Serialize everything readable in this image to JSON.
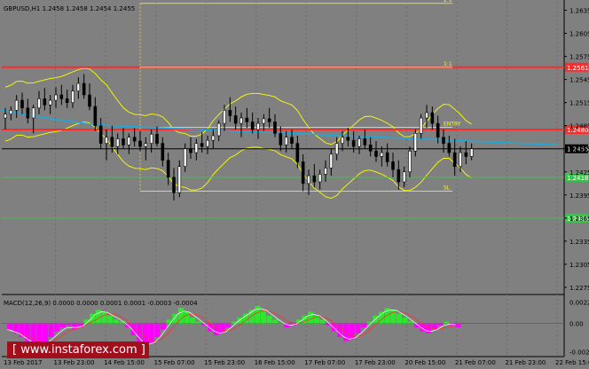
{
  "chart_data": [
    {
      "type": "candlestick",
      "title": "GBPUSD,H1  1.2458 1.2458 1.2454 1.2455",
      "symbol": "GBPUSD",
      "timeframe": "H1",
      "ohlc_header": [
        1.2458,
        1.2458,
        1.2454,
        1.2455
      ],
      "ylim": [
        1.2268,
        1.2646
      ],
      "y_ticks": [
        "1.2635",
        "1.2605",
        "1.2575",
        "1.2545",
        "1.2515",
        "1.2485",
        "1.2455",
        "1.2425",
        "1.2395",
        "1.2365",
        "1.2335",
        "1.2305",
        "1.2275"
      ],
      "x_ticks": [
        "13 Feb 2017",
        "13 Feb 23:00",
        "14 Feb 15:00",
        "15 Feb 07:00",
        "15 Feb 23:00",
        "16 Feb 15:00",
        "17 Feb 07:00",
        "17 Feb 23:00",
        "20 Feb 15:00",
        "21 Feb 07:00",
        "21 Feb 23:00",
        "22 Feb 15:00"
      ],
      "current_price": {
        "value": 1.2455,
        "label": "1.2455"
      },
      "horizontal_levels": [
        {
          "value": 1.2561,
          "label": "1.2561",
          "color": "#ff2b2b"
        },
        {
          "value": 1.248,
          "label": "1.2480",
          "color": "#ff2b2b"
        },
        {
          "value": 1.2418,
          "label": "1.2418",
          "color": "#2ecc40"
        },
        {
          "value": 1.2365,
          "label": "1.2365",
          "color": "#2ecc40"
        }
      ],
      "fib_levels": [
        {
          "value": 1.2644,
          "label": "2:1"
        },
        {
          "value": 1.2561,
          "label": "1:1"
        },
        {
          "value": 1.2483,
          "label": "ENTRY"
        },
        {
          "value": 1.24,
          "label": "SL"
        }
      ],
      "series": [
        {
          "type": "candles",
          "values": [
            [
              1.2495,
              1.2508,
              1.248,
              1.25
            ],
            [
              1.25,
              1.251,
              1.2492,
              1.2505
            ],
            [
              1.2505,
              1.2525,
              1.2495,
              1.2518
            ],
            [
              1.2518,
              1.2528,
              1.25,
              1.2508
            ],
            [
              1.2508,
              1.252,
              1.2488,
              1.2495
            ],
            [
              1.2495,
              1.2512,
              1.2475,
              1.2508
            ],
            [
              1.2508,
              1.253,
              1.25,
              1.252
            ],
            [
              1.252,
              1.2534,
              1.2505,
              1.2512
            ],
            [
              1.2512,
              1.2525,
              1.25,
              1.2518
            ],
            [
              1.2518,
              1.2535,
              1.2508,
              1.2525
            ],
            [
              1.2525,
              1.2538,
              1.2512,
              1.252
            ],
            [
              1.252,
              1.2532,
              1.2508,
              1.2515
            ],
            [
              1.2515,
              1.2538,
              1.2508,
              1.253
            ],
            [
              1.253,
              1.2548,
              1.252,
              1.254
            ],
            [
              1.254,
              1.2552,
              1.252,
              1.2525
            ],
            [
              1.2525,
              1.254,
              1.2505,
              1.251
            ],
            [
              1.251,
              1.2522,
              1.2478,
              1.2485
            ],
            [
              1.2485,
              1.2495,
              1.2455,
              1.2462
            ],
            [
              1.2462,
              1.248,
              1.244,
              1.247
            ],
            [
              1.247,
              1.2485,
              1.245,
              1.2458
            ],
            [
              1.2458,
              1.2475,
              1.2448,
              1.2468
            ],
            [
              1.2468,
              1.2482,
              1.2455,
              1.246
            ],
            [
              1.246,
              1.2475,
              1.2448,
              1.247
            ],
            [
              1.247,
              1.2482,
              1.2458,
              1.2465
            ],
            [
              1.2465,
              1.2478,
              1.2452,
              1.2458
            ],
            [
              1.2458,
              1.247,
              1.244,
              1.2462
            ],
            [
              1.2462,
              1.248,
              1.245,
              1.2474
            ],
            [
              1.2474,
              1.2484,
              1.2458,
              1.2462
            ],
            [
              1.2462,
              1.247,
              1.2432,
              1.244
            ],
            [
              1.244,
              1.245,
              1.2408,
              1.2418
            ],
            [
              1.2418,
              1.243,
              1.2388,
              1.2398
            ],
            [
              1.2398,
              1.244,
              1.2392,
              1.2432
            ],
            [
              1.2432,
              1.2462,
              1.2425,
              1.2455
            ],
            [
              1.2455,
              1.247,
              1.2442,
              1.245
            ],
            [
              1.245,
              1.2468,
              1.244,
              1.2462
            ],
            [
              1.2462,
              1.2476,
              1.245,
              1.2458
            ],
            [
              1.2458,
              1.2472,
              1.2448,
              1.2466
            ],
            [
              1.2466,
              1.248,
              1.2455,
              1.2472
            ],
            [
              1.2472,
              1.2492,
              1.2465,
              1.2488
            ],
            [
              1.2488,
              1.2512,
              1.2478,
              1.2505
            ],
            [
              1.2505,
              1.2522,
              1.249,
              1.2498
            ],
            [
              1.2498,
              1.251,
              1.248,
              1.2488
            ],
            [
              1.2488,
              1.2502,
              1.247,
              1.2495
            ],
            [
              1.2495,
              1.2508,
              1.2482,
              1.249
            ],
            [
              1.249,
              1.2502,
              1.2475,
              1.248
            ],
            [
              1.248,
              1.2495,
              1.2468,
              1.2488
            ],
            [
              1.2488,
              1.25,
              1.2478,
              1.2494
            ],
            [
              1.2494,
              1.2508,
              1.2482,
              1.249
            ],
            [
              1.249,
              1.25,
              1.247,
              1.2475
            ],
            [
              1.2475,
              1.2484,
              1.2452,
              1.246
            ],
            [
              1.246,
              1.2478,
              1.245,
              1.247
            ],
            [
              1.247,
              1.248,
              1.2455,
              1.2462
            ],
            [
              1.2462,
              1.2472,
              1.243,
              1.2438
            ],
            [
              1.2438,
              1.2448,
              1.24,
              1.241
            ],
            [
              1.241,
              1.2428,
              1.2395,
              1.242
            ],
            [
              1.242,
              1.2435,
              1.2405,
              1.2412
            ],
            [
              1.2412,
              1.2428,
              1.2402,
              1.2422
            ],
            [
              1.2422,
              1.244,
              1.2412,
              1.243
            ],
            [
              1.243,
              1.2455,
              1.242,
              1.2448
            ],
            [
              1.2448,
              1.247,
              1.244,
              1.2462
            ],
            [
              1.2462,
              1.2478,
              1.2452,
              1.247
            ],
            [
              1.247,
              1.2482,
              1.2458,
              1.2466
            ],
            [
              1.2466,
              1.2478,
              1.245,
              1.2458
            ],
            [
              1.2458,
              1.2472,
              1.2448,
              1.2468
            ],
            [
              1.2468,
              1.248,
              1.2455,
              1.246
            ],
            [
              1.246,
              1.247,
              1.2445,
              1.2452
            ],
            [
              1.2452,
              1.2465,
              1.2438,
              1.2445
            ],
            [
              1.2445,
              1.2458,
              1.2432,
              1.245
            ],
            [
              1.245,
              1.2462,
              1.2432,
              1.2438
            ],
            [
              1.2438,
              1.245,
              1.2418,
              1.2428
            ],
            [
              1.2428,
              1.244,
              1.2402,
              1.2412
            ],
            [
              1.2412,
              1.2432,
              1.2405,
              1.2425
            ],
            [
              1.2425,
              1.2458,
              1.2418,
              1.2452
            ],
            [
              1.2452,
              1.248,
              1.2445,
              1.2475
            ],
            [
              1.2475,
              1.25,
              1.2468,
              1.2495
            ],
            [
              1.2495,
              1.2512,
              1.2482,
              1.2502
            ],
            [
              1.2502,
              1.251,
              1.248,
              1.2488
            ],
            [
              1.2488,
              1.2498,
              1.2462,
              1.247
            ],
            [
              1.247,
              1.248,
              1.245,
              1.2462
            ],
            [
              1.2462,
              1.2472,
              1.2445,
              1.245
            ],
            [
              1.245,
              1.2468,
              1.242,
              1.2432
            ],
            [
              1.2432,
              1.2458,
              1.2425,
              1.245
            ],
            [
              1.245,
              1.2465,
              1.2435,
              1.2445
            ],
            [
              1.2445,
              1.2462,
              1.244,
              1.2455
            ]
          ]
        },
        {
          "name": "",
          "type": "line",
          "color": "#22a8d8",
          "values": [
            1.2505,
            1.2501,
            1.2497,
            1.2493,
            1.249,
            1.2487,
            1.2485,
            1.2484,
            1.2483,
            1.2482,
            1.2481,
            1.248,
            1.2479,
            1.2478,
            1.2477,
            1.2476,
            1.2475,
            1.2474,
            1.2473,
            1.2472,
            1.2471,
            1.247,
            1.2469,
            1.2468,
            1.2467,
            1.2466,
            1.2465,
            1.2464,
            1.2463,
            1.2462,
            1.2461,
            1.246
          ]
        }
      ]
    },
    {
      "type": "bar",
      "title": "MACD(12,26,9)  0.0000 0.0000 0.0001 0.0001 -0.0003 -0.0004",
      "ylim": [
        -0.0032,
        0.0026
      ],
      "y_ticks": [
        "0.0022",
        "0.00",
        "-0.0029"
      ],
      "values": [
        -0.0006,
        -0.001,
        -0.0014,
        -0.0018,
        -0.0022,
        -0.0024,
        -0.002,
        -0.0014,
        -0.0008,
        -0.0004,
        -0.0002,
        -0.0006,
        -0.0004,
        0.0004,
        0.001,
        0.0014,
        0.0012,
        0.0008,
        0.0004,
        0.0002,
        -0.0004,
        -0.0012,
        -0.002,
        -0.0024,
        -0.002,
        -0.0014,
        -0.0006,
        0.0004,
        0.001,
        0.0016,
        0.0012,
        0.0006,
        0.0002,
        -0.0002,
        -0.0008,
        -0.0012,
        -0.001,
        -0.0004,
        0.0002,
        0.0006,
        0.001,
        0.0014,
        0.0018,
        0.0014,
        0.0008,
        0.0004,
        0.0,
        -0.0004,
        -0.0002,
        0.0004,
        0.0008,
        0.0012,
        0.0008,
        0.0004,
        -0.0002,
        -0.0008,
        -0.0014,
        -0.0018,
        -0.0016,
        -0.001,
        -0.0004,
        0.0002,
        0.0008,
        0.0012,
        0.0016,
        0.0014,
        0.001,
        0.0006,
        0.0002,
        -0.0004,
        -0.0008,
        -0.001,
        -0.0006,
        -0.0002,
        0.0002,
        -0.0002,
        -0.0004
      ]
    }
  ],
  "watermark": {
    "text": "[ www.instaforex.com ]",
    "color": "#a10f1c"
  },
  "colors": {
    "background": "#808080",
    "candle": "#000000",
    "ma": "#22a8d8",
    "bands": "#ffff00",
    "grid": "#6b6b6b",
    "axis_text": "#000000"
  }
}
